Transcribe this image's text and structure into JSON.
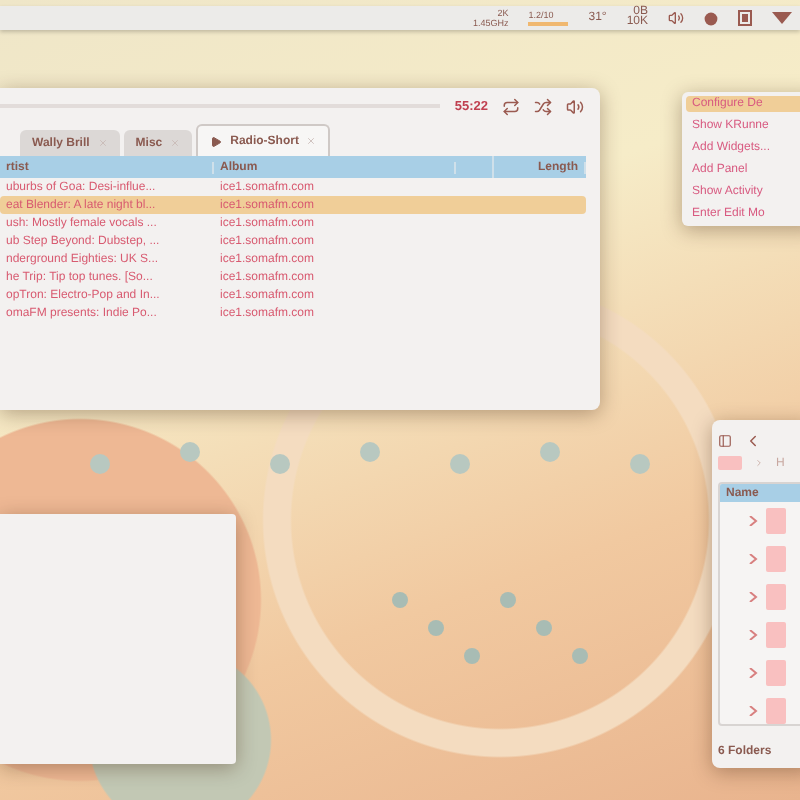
{
  "panel": {
    "cpu": {
      "top": "2K",
      "bottom": "1.45GHz"
    },
    "memory": {
      "label": "1.2/10",
      "level": 1
    },
    "temperature": "31°",
    "network": {
      "top": "0B",
      "bottom": "10K"
    }
  },
  "player": {
    "time": "55:22",
    "tabs": [
      {
        "label": "Wally Brill",
        "selected": false,
        "playing": false
      },
      {
        "label": "Misc",
        "selected": false,
        "playing": false
      },
      {
        "label": "Radio-Short",
        "selected": true,
        "playing": true
      }
    ],
    "columns": [
      {
        "label": "rtist"
      },
      {
        "label": "Album"
      },
      {
        "label": "Length"
      }
    ],
    "rows": [
      {
        "artist": "uburbs of Goa: Desi-influe...",
        "album": "ice1.somafm.com",
        "selected": false
      },
      {
        "artist": "eat Blender: A late night bl...",
        "album": "ice1.somafm.com",
        "selected": true
      },
      {
        "artist": "ush: Mostly female vocals ...",
        "album": "ice1.somafm.com",
        "selected": false
      },
      {
        "artist": "ub Step Beyond: Dubstep, ...",
        "album": "ice1.somafm.com",
        "selected": false
      },
      {
        "artist": "nderground Eighties: UK S...",
        "album": "ice1.somafm.com",
        "selected": false
      },
      {
        "artist": "he Trip:  Tip top tunes. [So...",
        "album": "ice1.somafm.com",
        "selected": false
      },
      {
        "artist": "opTron: Electro-Pop and In...",
        "album": "ice1.somafm.com",
        "selected": false
      },
      {
        "artist": "omaFM presents: Indie Po...",
        "album": "ice1.somafm.com",
        "selected": false
      }
    ]
  },
  "desktop_menu": {
    "items": [
      {
        "label": "Configure De",
        "selected": true
      },
      {
        "label": "Show KRunne",
        "selected": false
      },
      {
        "label": "Add Widgets...",
        "selected": false
      },
      {
        "label": "Add Panel",
        "selected": false
      },
      {
        "label": "Show Activity",
        "selected": false
      },
      {
        "label": "Enter Edit Mo",
        "selected": false
      }
    ]
  },
  "file_manager": {
    "breadcrumb": "H",
    "column": "Name",
    "folders": [
      {
        "expanded": false
      },
      {
        "expanded": false
      },
      {
        "expanded": false
      },
      {
        "expanded": false
      },
      {
        "expanded": false
      },
      {
        "expanded": false
      }
    ],
    "status": "6 Folders"
  }
}
